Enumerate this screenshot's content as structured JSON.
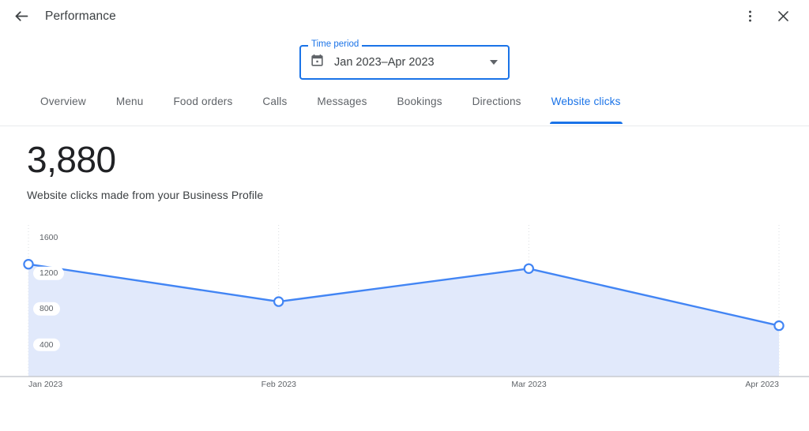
{
  "header": {
    "back_icon": "back-arrow-icon",
    "title": "Performance",
    "overflow_icon": "more-vert-icon",
    "close_icon": "close-icon"
  },
  "time_period": {
    "legend": "Time period",
    "value": "Jan 2023–Apr 2023",
    "calendar_icon": "calendar-icon",
    "dropdown_icon": "chevron-down-icon"
  },
  "tabs": [
    {
      "label": "Overview",
      "active": false
    },
    {
      "label": "Menu",
      "active": false
    },
    {
      "label": "Food orders",
      "active": false
    },
    {
      "label": "Calls",
      "active": false
    },
    {
      "label": "Messages",
      "active": false
    },
    {
      "label": "Bookings",
      "active": false
    },
    {
      "label": "Directions",
      "active": false
    },
    {
      "label": "Website clicks",
      "active": true
    }
  ],
  "metric": {
    "value": "3,880",
    "description": "Website clicks made from your Business Profile"
  },
  "colors": {
    "accent": "#1a73e8",
    "line": "#4285f4",
    "fill": "#e1e9fb",
    "grid": "#dadce0",
    "text_secondary": "#5f6368"
  },
  "chart_data": {
    "type": "area",
    "title": "Website clicks",
    "xlabel": "",
    "ylabel": "",
    "categories": [
      "Jan 2023",
      "Feb 2023",
      "Mar 2023",
      "Apr 2023"
    ],
    "values": [
      1260,
      840,
      1210,
      570
    ],
    "ytick_labels": [
      "1600",
      "1200",
      "800",
      "400"
    ],
    "yticks": [
      1600,
      1200,
      800,
      400
    ],
    "ylim": [
      0,
      1700
    ],
    "grid": true,
    "legend": "none",
    "series": [
      {
        "name": "Website clicks",
        "values": [
          1260,
          840,
          1210,
          570
        ]
      }
    ]
  }
}
